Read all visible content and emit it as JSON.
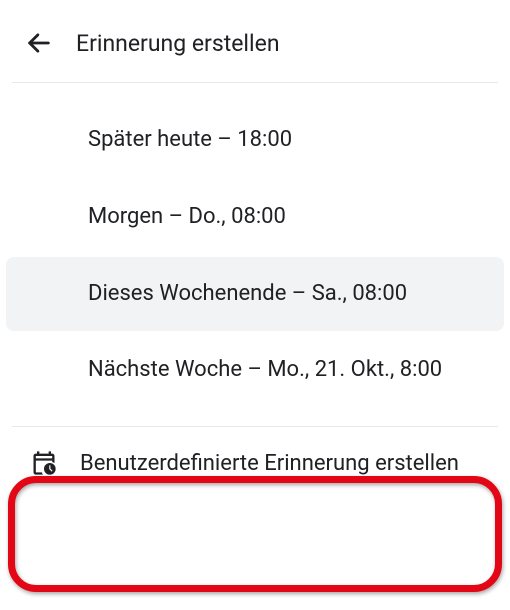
{
  "header": {
    "title": "Erinnerung erstellen"
  },
  "options": [
    {
      "label": "Später heute – 18:00",
      "hovered": false
    },
    {
      "label": "Morgen – Do., 08:00",
      "hovered": false
    },
    {
      "label": "Dieses Wochenende – Sa., 08:00",
      "hovered": true
    },
    {
      "label": "Nächste Woche – Mo., 21. Okt., 8:00",
      "hovered": false
    }
  ],
  "custom": {
    "label": "Benutzerdefinierte Erinnerung erstellen"
  }
}
